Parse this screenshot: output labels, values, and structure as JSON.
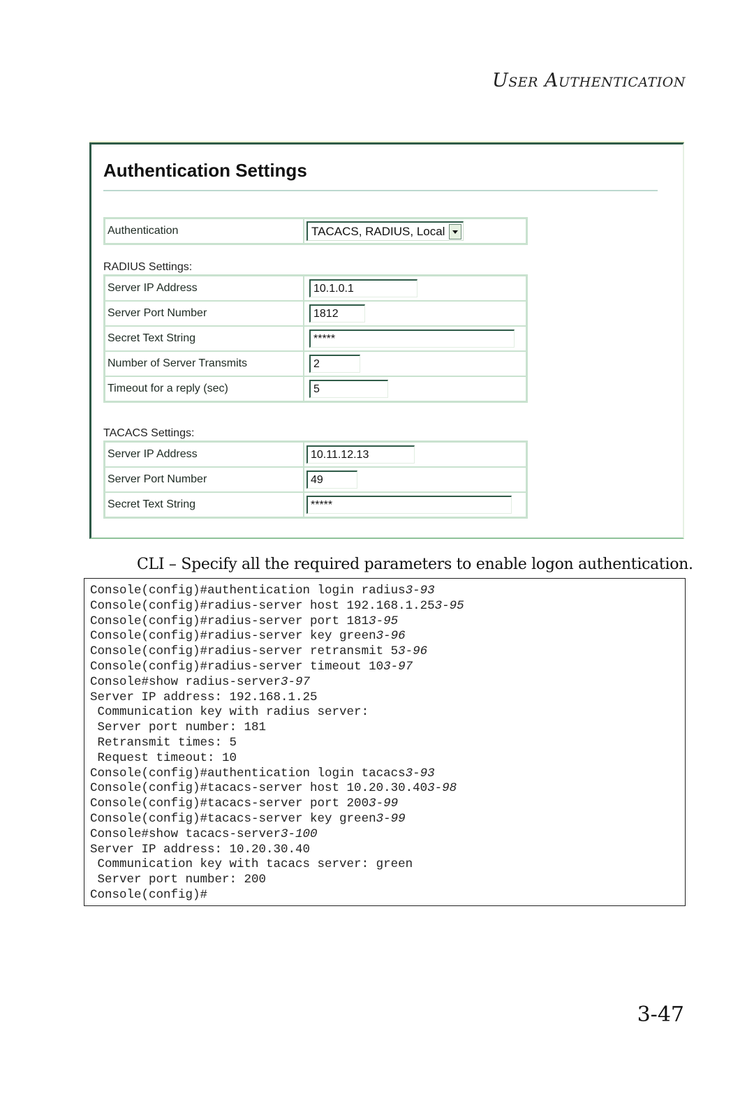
{
  "running_head": "User Authentication",
  "screenshot": {
    "title": "Authentication Settings",
    "authentication": {
      "label": "Authentication",
      "selected": "TACACS, RADIUS, Local"
    },
    "radius": {
      "section_label": "RADIUS Settings:",
      "rows": [
        {
          "label": "Server IP Address",
          "value": "10.1.0.1"
        },
        {
          "label": "Server Port Number",
          "value": "1812"
        },
        {
          "label": "Secret Text String",
          "value": "*****"
        },
        {
          "label": "Number of Server Transmits",
          "value": "2"
        },
        {
          "label": "Timeout for a reply (sec)",
          "value": "5"
        }
      ]
    },
    "tacacs": {
      "section_label": "TACACS Settings:",
      "rows": [
        {
          "label": "Server IP Address",
          "value": "10.11.12.13"
        },
        {
          "label": "Server Port Number",
          "value": "49"
        },
        {
          "label": "Secret Text String",
          "value": "*****"
        }
      ]
    }
  },
  "caption": "CLI – Specify all the required parameters to enable logon authentication.",
  "cli": [
    {
      "text": "Console(config)#authentication login radius",
      "ref": "3-93"
    },
    {
      "text": "Console(config)#radius-server host 192.168.1.25",
      "ref": "3-95"
    },
    {
      "text": "Console(config)#radius-server port 181",
      "ref": "3-95"
    },
    {
      "text": "Console(config)#radius-server key green",
      "ref": "3-96"
    },
    {
      "text": "Console(config)#radius-server retransmit 5",
      "ref": "3-96"
    },
    {
      "text": "Console(config)#radius-server timeout 10",
      "ref": "3-97"
    },
    {
      "text": "Console#show radius-server",
      "ref": "3-97"
    },
    {
      "text": "Server IP address: 192.168.1.25",
      "ref": ""
    },
    {
      "text": " Communication key with radius server:",
      "ref": ""
    },
    {
      "text": " Server port number: 181",
      "ref": ""
    },
    {
      "text": " Retransmit times: 5",
      "ref": ""
    },
    {
      "text": " Request timeout: 10",
      "ref": ""
    },
    {
      "text": "Console(config)#authentication login tacacs",
      "ref": "3-93"
    },
    {
      "text": "Console(config)#tacacs-server host 10.20.30.40",
      "ref": "3-98"
    },
    {
      "text": "Console(config)#tacacs-server port 200",
      "ref": "3-99"
    },
    {
      "text": "Console(config)#tacacs-server key green",
      "ref": "3-99"
    },
    {
      "text": "Console#show tacacs-server",
      "ref": "3-100"
    },
    {
      "text": "Server IP address: 10.20.30.40",
      "ref": ""
    },
    {
      "text": " Communication key with tacacs server: green",
      "ref": ""
    },
    {
      "text": " Server port number: 200",
      "ref": ""
    },
    {
      "text": "Console(config)#",
      "ref": ""
    }
  ],
  "page_number": "3-47"
}
